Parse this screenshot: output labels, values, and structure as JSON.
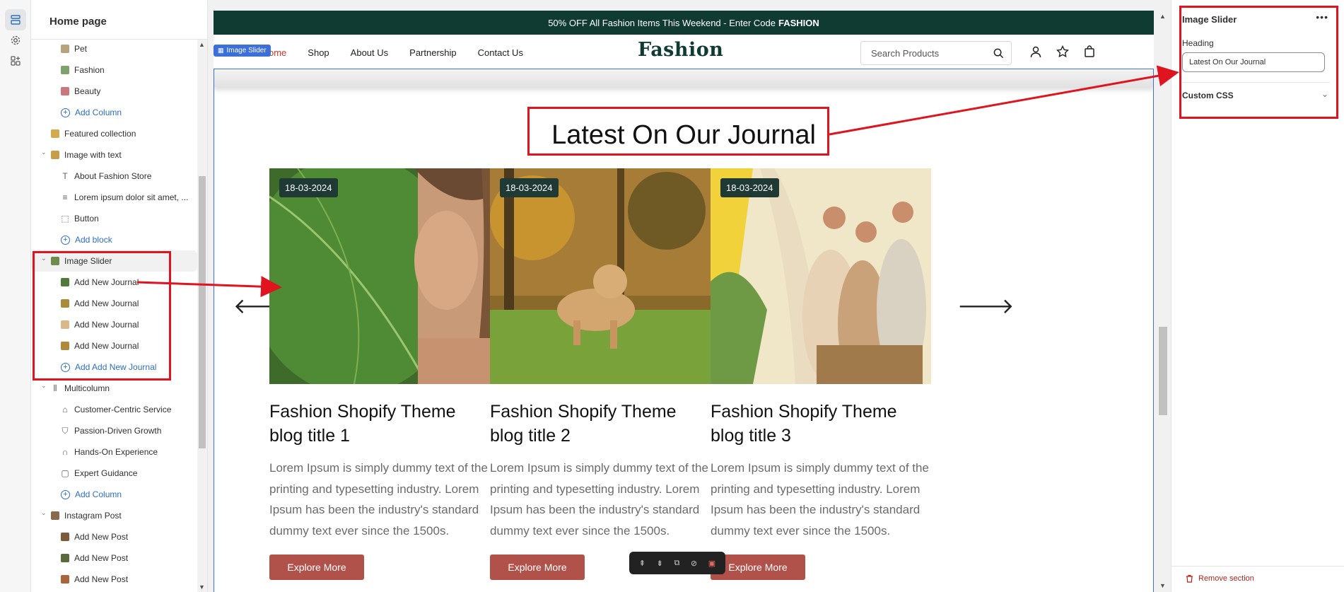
{
  "tree": {
    "title": "Home page",
    "items": [
      {
        "label": "Pet",
        "kind": "child",
        "icon": "image-thumb",
        "color": "#b7a37d"
      },
      {
        "label": "Fashion",
        "kind": "child",
        "icon": "image-thumb",
        "color": "#7fa16b"
      },
      {
        "label": "Beauty",
        "kind": "child",
        "icon": "image-thumb",
        "color": "#c9787c"
      },
      {
        "label": "Add Column",
        "kind": "add"
      },
      {
        "label": "Featured collection",
        "kind": "section",
        "icon": "image-thumb",
        "color": "#d4a94f"
      },
      {
        "label": "Image with text",
        "kind": "section",
        "expanded": true,
        "icon": "image-thumb",
        "color": "#c79d4a"
      },
      {
        "label": "About Fashion Store",
        "kind": "child",
        "icon": "text-icon"
      },
      {
        "label": "Lorem ipsum dolor sit amet, ...",
        "kind": "child",
        "icon": "paragraph-icon"
      },
      {
        "label": "Button",
        "kind": "child",
        "icon": "button-icon"
      },
      {
        "label": "Add block",
        "kind": "add"
      },
      {
        "label": "Image Slider",
        "kind": "section",
        "expanded": true,
        "selected": true,
        "icon": "image-thumb",
        "color": "#6e8c4c"
      },
      {
        "label": "Add New Journal",
        "kind": "child",
        "icon": "image-thumb",
        "color": "#4f7a3a"
      },
      {
        "label": "Add New Journal",
        "kind": "child",
        "icon": "image-thumb",
        "color": "#a98b3a"
      },
      {
        "label": "Add New Journal",
        "kind": "child",
        "icon": "image-thumb",
        "color": "#d9b98a"
      },
      {
        "label": "Add New Journal",
        "kind": "child",
        "icon": "image-thumb",
        "color": "#b08a3a"
      },
      {
        "label": "Add Add New Journal",
        "kind": "add"
      },
      {
        "label": "Multicolumn",
        "kind": "section",
        "expanded": true,
        "icon": "multicolumn-icon"
      },
      {
        "label": "Customer-Centric Service",
        "kind": "child",
        "icon": "tag-icon"
      },
      {
        "label": "Passion-Driven Growth",
        "kind": "child",
        "icon": "bag-icon"
      },
      {
        "label": "Hands-On Experience",
        "kind": "child",
        "icon": "headphones-icon"
      },
      {
        "label": "Expert Guidance",
        "kind": "child",
        "icon": "box-icon"
      },
      {
        "label": "Add Column",
        "kind": "add"
      },
      {
        "label": "Instagram Post",
        "kind": "section",
        "expanded": true,
        "icon": "image-thumb",
        "color": "#8a6a4a"
      },
      {
        "label": "Add New Post",
        "kind": "child",
        "icon": "image-thumb",
        "color": "#7a5a3a"
      },
      {
        "label": "Add New Post",
        "kind": "child",
        "icon": "image-thumb",
        "color": "#5a6a3a"
      },
      {
        "label": "Add New Post",
        "kind": "child",
        "icon": "image-thumb",
        "color": "#a8663a"
      }
    ]
  },
  "preview": {
    "announcement": "50% OFF All Fashion Items This Weekend - Enter Code",
    "announcement_code": "FASHION",
    "section_tag": "Image Slider",
    "nav": [
      "ome",
      "Shop",
      "About Us",
      "Partnership",
      "Contact Us"
    ],
    "logo": "Fashion",
    "search_placeholder": "Search Products",
    "heading": "Latest On Our Journal",
    "cards": [
      {
        "date": "18-03-2024",
        "title": "Fashion Shopify Theme blog title 1",
        "text": "Lorem Ipsum is simply dummy text of the printing and typesetting industry. Lorem Ipsum has been the industry's standard dummy text ever since the 1500s.",
        "button": "Explore More"
      },
      {
        "date": "18-03-2024",
        "title": "Fashion Shopify Theme blog title 2",
        "text": "Lorem Ipsum is simply dummy text of the printing and typesetting industry. Lorem Ipsum has been the industry's standard dummy text ever since the 1500s.",
        "button": "Explore More"
      },
      {
        "date": "18-03-2024",
        "title": "Fashion Shopify Theme blog title 3",
        "text": "Lorem Ipsum is simply dummy text of the printing and typesetting industry. Lorem Ipsum has been the industry's standard dummy text ever since the 1500s.",
        "button": "Explore More"
      }
    ]
  },
  "settings": {
    "title": "Image Slider",
    "heading_label": "Heading",
    "heading_value": "Latest On Our Journal",
    "custom_css_label": "Custom CSS",
    "remove_label": "Remove section"
  },
  "colors": {
    "accent": "#2c6ecb",
    "brand": "#0f3b33",
    "button": "#b0524a",
    "annotation": "#e0141e"
  }
}
